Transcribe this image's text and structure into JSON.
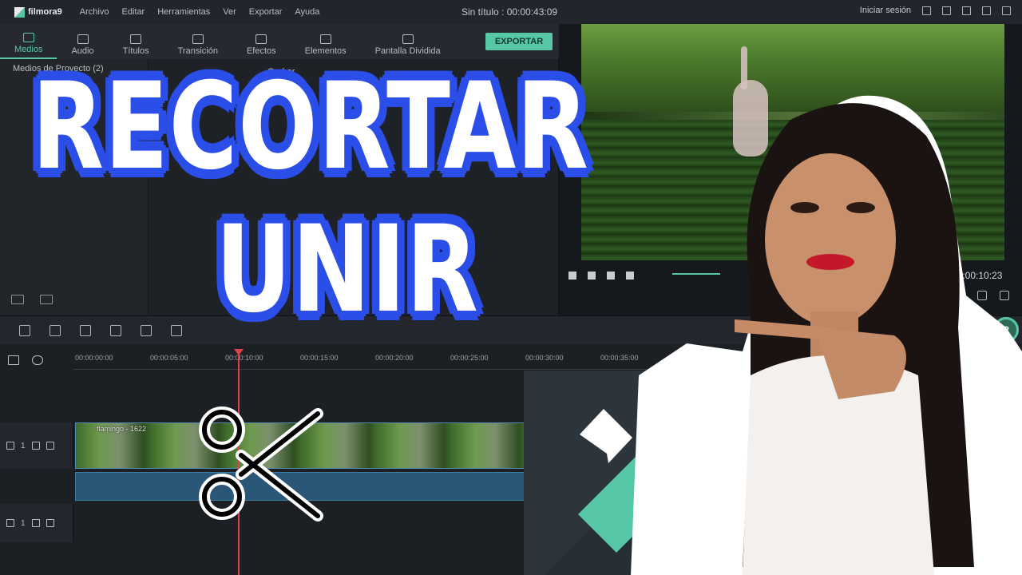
{
  "app": {
    "logo_text": "filmora9",
    "menu": [
      "Archivo",
      "Editar",
      "Herramientas",
      "Ver",
      "Exportar",
      "Ayuda"
    ],
    "project_title": "Sin título : 00:00:43:09",
    "login_label": "Iniciar sesión"
  },
  "tabs": [
    {
      "label": "Medios",
      "icon": "folder-icon",
      "active": true
    },
    {
      "label": "Audio",
      "icon": "music-note-icon",
      "active": false
    },
    {
      "label": "Títulos",
      "icon": "text-icon",
      "active": false
    },
    {
      "label": "Transición",
      "icon": "transition-icon",
      "active": false
    },
    {
      "label": "Efectos",
      "icon": "effects-icon",
      "active": false
    },
    {
      "label": "Elementos",
      "icon": "image-icon",
      "active": false
    },
    {
      "label": "Pantalla Dividida",
      "icon": "split-screen-icon",
      "active": false
    }
  ],
  "export_label": "EXPORTAR",
  "media": {
    "project_media_label": "Medios de Proyecto (2)",
    "record_label": "Grabar"
  },
  "preview": {
    "timecode": "00:00:10:23",
    "progress": 0.24
  },
  "timeline": {
    "ticks": [
      "00:00:00:00",
      "00:00:05:00",
      "00:00:10:00",
      "00:00:15:00",
      "00:00:20:00",
      "00:00:25:00",
      "00:00:30:00",
      "00:00:35:00"
    ],
    "video_track_label": "1",
    "audio_track_label": "1",
    "clip_name": "flamingo - 1622"
  },
  "overlay": {
    "line1": "RECORTAR",
    "line2": "UNIR"
  },
  "colors": {
    "accent": "#56c7a7",
    "headline_outline": "#2b4ee8",
    "playhead": "#e0424a"
  }
}
